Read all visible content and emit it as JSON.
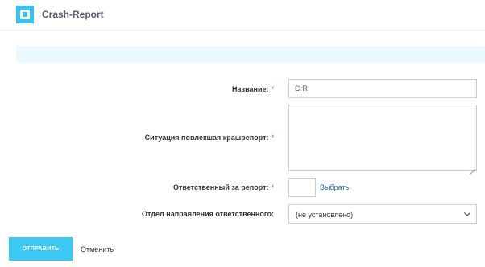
{
  "header": {
    "title": "Crash-Report"
  },
  "form": {
    "name": {
      "label": "Название:",
      "required_mark": "*",
      "value": "CrR"
    },
    "situation": {
      "label": "Ситуация повлекшая крашрепорт:",
      "required_mark": "*",
      "value": ""
    },
    "responsible": {
      "label": "Ответственный за репорт:",
      "required_mark": "*",
      "choose_link": "Выбрать"
    },
    "department": {
      "label": "Отдел направления ответственного:",
      "selected": "(не установлено)"
    }
  },
  "actions": {
    "submit_label": "ОТПРАВИТЬ",
    "cancel_label": "Отменить"
  },
  "colors": {
    "accent": "#3bc8f5",
    "required": "#e8431f",
    "link": "#2067b0",
    "info_bar": "#ebfafe"
  },
  "icons": {
    "logo": "app-logo-icon",
    "select": "chevron-down-icon"
  }
}
